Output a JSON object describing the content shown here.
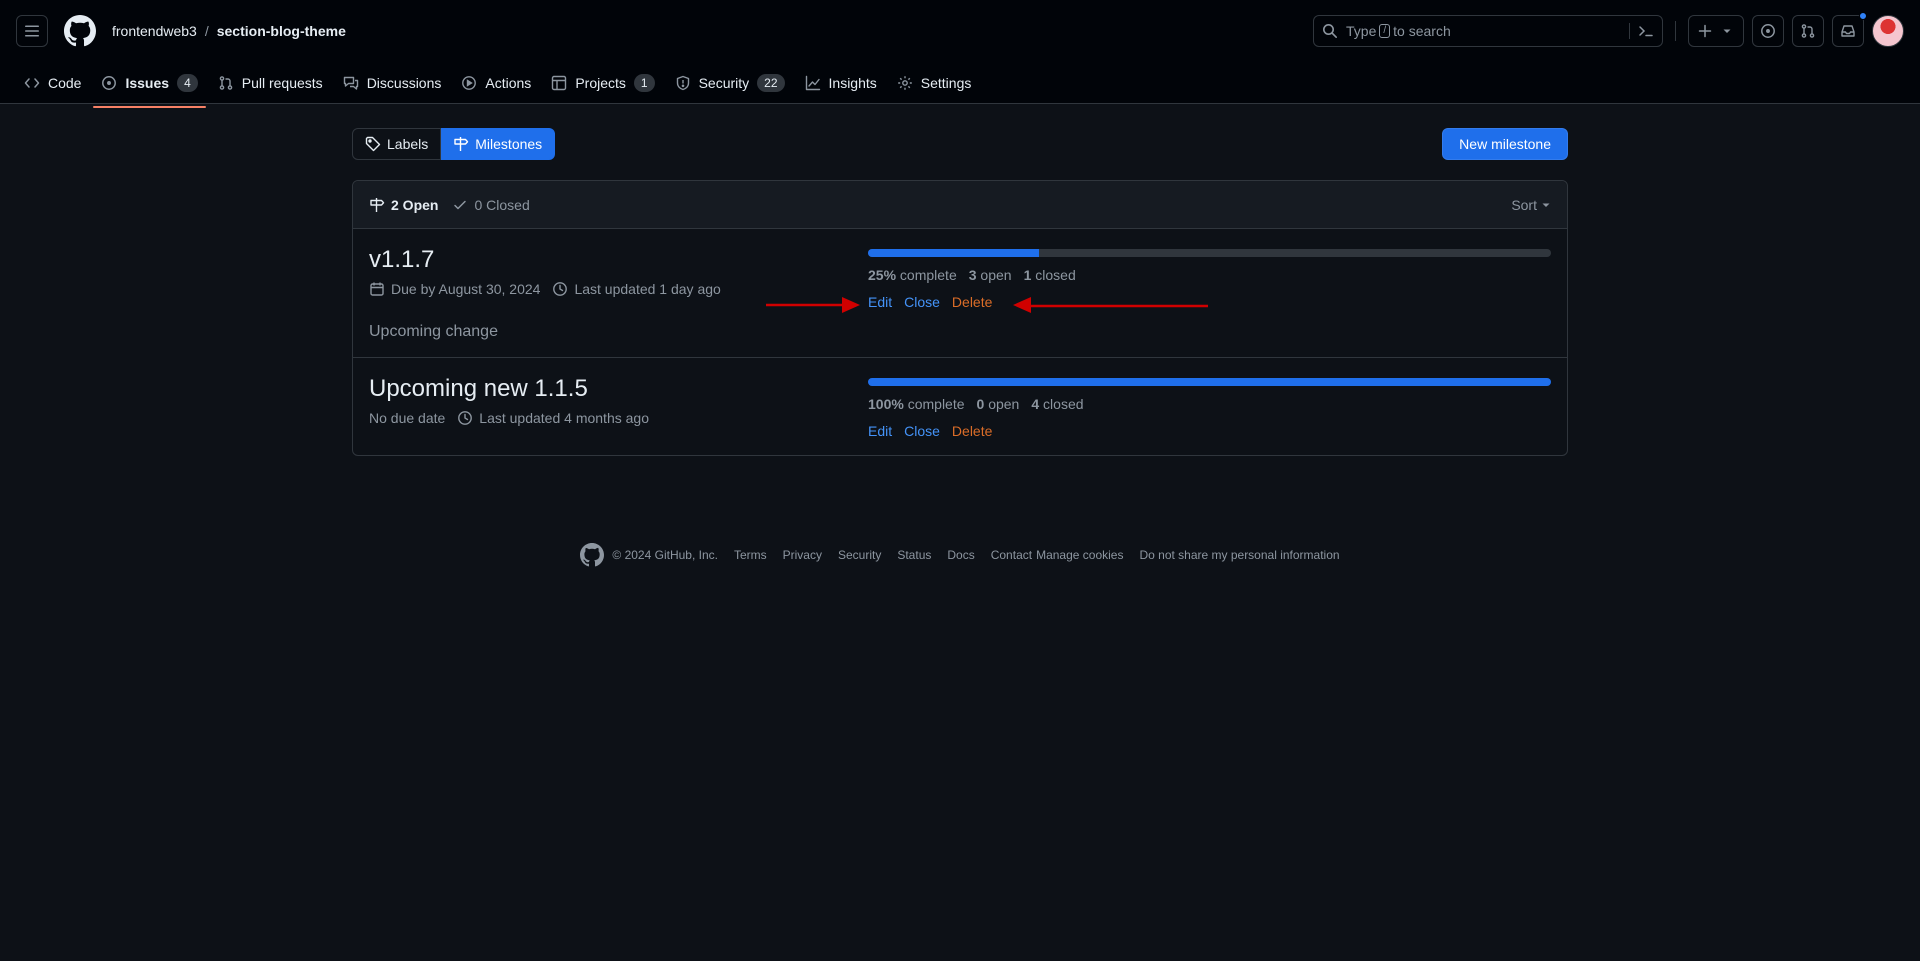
{
  "header": {
    "owner": "frontendweb3",
    "separator": "/",
    "repo": "section-blog-theme",
    "search": {
      "before": "Type",
      "key": "/",
      "after": "to search"
    }
  },
  "tabs": [
    {
      "label": "Code",
      "icon": "code-icon"
    },
    {
      "label": "Issues",
      "icon": "issue-opened-icon",
      "count": "4",
      "active": true
    },
    {
      "label": "Pull requests",
      "icon": "git-pull-request-icon"
    },
    {
      "label": "Discussions",
      "icon": "comment-discussion-icon"
    },
    {
      "label": "Actions",
      "icon": "play-icon"
    },
    {
      "label": "Projects",
      "icon": "table-icon",
      "count": "1"
    },
    {
      "label": "Security",
      "icon": "shield-icon",
      "count": "22"
    },
    {
      "label": "Insights",
      "icon": "graph-icon"
    },
    {
      "label": "Settings",
      "icon": "gear-icon"
    }
  ],
  "subnav": {
    "labels": "Labels",
    "milestones": "Milestones",
    "new_milestone": "New milestone"
  },
  "list_header": {
    "open": "2 Open",
    "closed": "0 Closed",
    "sort": "Sort"
  },
  "milestones": [
    {
      "title": "v1.1.7",
      "due": "Due by August 30, 2024",
      "updated": "Last updated 1 day ago",
      "description": "Upcoming change",
      "progress": 0.25,
      "percent": "25%",
      "complete_label": "complete",
      "open_count": "3",
      "open_label": "open",
      "closed_count": "1",
      "closed_label": "closed",
      "edit": "Edit",
      "close": "Close",
      "delete": "Delete"
    },
    {
      "title": "Upcoming new 1.1.5",
      "due": "No due date",
      "updated": "Last updated 4 months ago",
      "progress": 1.0,
      "percent": "100%",
      "complete_label": "complete",
      "open_count": "0",
      "open_label": "open",
      "closed_count": "4",
      "closed_label": "closed",
      "edit": "Edit",
      "close": "Close",
      "delete": "Delete"
    }
  ],
  "footer": {
    "copyright": "© 2024 GitHub, Inc.",
    "links": [
      "Terms",
      "Privacy",
      "Security",
      "Status",
      "Docs",
      "Contact",
      "Manage cookies",
      "Do not share my personal information"
    ]
  },
  "colors": {
    "background": "#0d1117",
    "header_bg": "#010409",
    "accent": "#1f6feb",
    "link": "#4493f8",
    "danger": "#db6d28",
    "annotation_arrow": "#d00000",
    "active_tab_underline": "#f78166"
  }
}
